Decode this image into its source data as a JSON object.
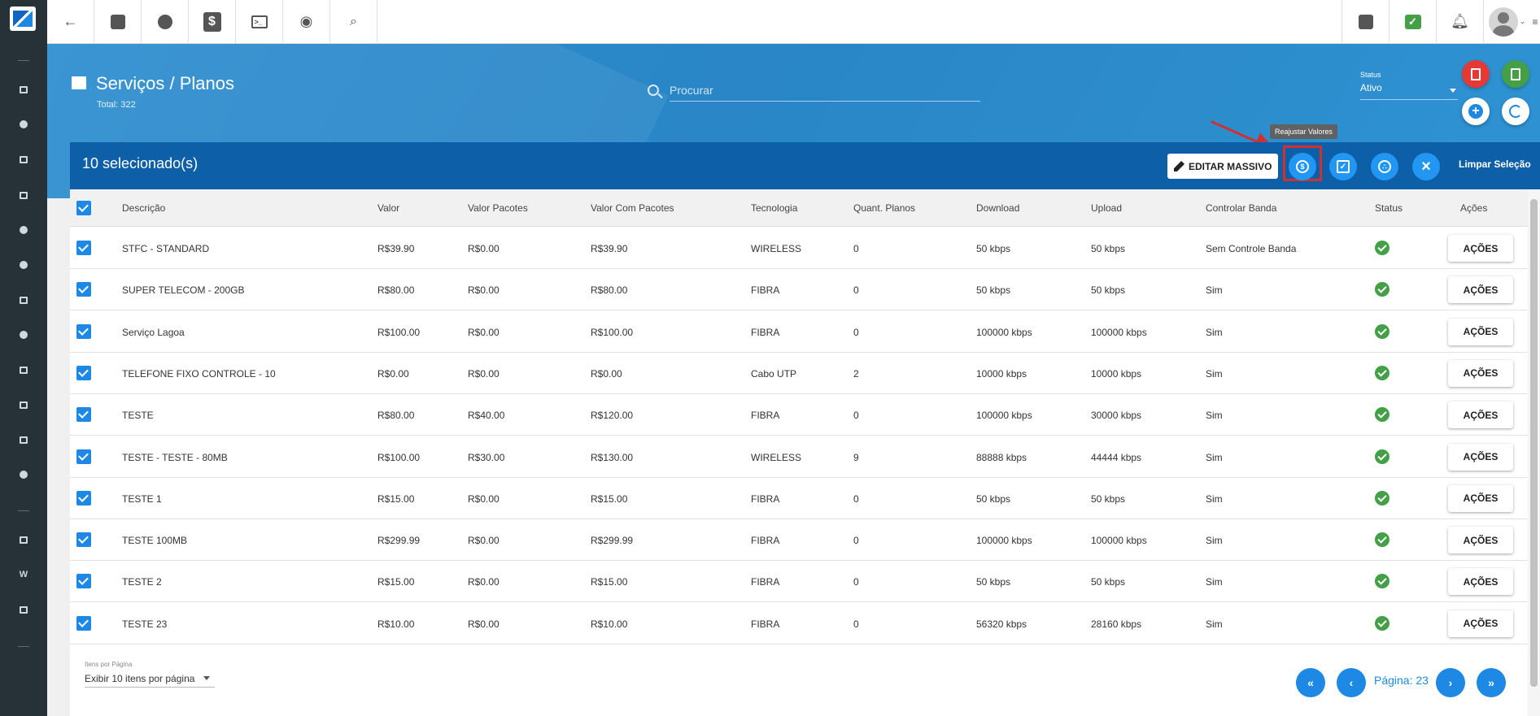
{
  "header": {
    "title": "Serviços / Planos",
    "total": "Total: 322",
    "search_placeholder": "Procurar",
    "status_label": "Status",
    "status_value": "Ativo"
  },
  "selection": {
    "count_label": "10 selecionado(s)",
    "edit_massivo_label": "EDITAR MASSIVO",
    "tooltip": "Reajustar Valores",
    "clear_label": "Limpar Seleção"
  },
  "table": {
    "columns": [
      "Descrição",
      "Valor",
      "Valor Pacotes",
      "Valor Com Pacotes",
      "Tecnologia",
      "Quant. Planos",
      "Download",
      "Upload",
      "Controlar Banda",
      "Status",
      "Ações"
    ],
    "action_label": "AÇÕES",
    "rows": [
      {
        "descricao": "STFC - STANDARD",
        "valor": "R$39.90",
        "valor_pacotes": "R$0.00",
        "valor_com_pacotes": "R$39.90",
        "tecnologia": "WIRELESS",
        "quant_planos": "0",
        "download": "50 kbps",
        "upload": "50 kbps",
        "controlar_banda": "Sem Controle Banda"
      },
      {
        "descricao": "SUPER TELECOM - 200GB",
        "valor": "R$80.00",
        "valor_pacotes": "R$0.00",
        "valor_com_pacotes": "R$80.00",
        "tecnologia": "FIBRA",
        "quant_planos": "0",
        "download": "50 kbps",
        "upload": "50 kbps",
        "controlar_banda": "Sim"
      },
      {
        "descricao": "Serviço Lagoa",
        "valor": "R$100.00",
        "valor_pacotes": "R$0.00",
        "valor_com_pacotes": "R$100.00",
        "tecnologia": "FIBRA",
        "quant_planos": "0",
        "download": "100000 kbps",
        "upload": "100000 kbps",
        "controlar_banda": "Sim"
      },
      {
        "descricao": "TELEFONE FIXO CONTROLE - 10",
        "valor": "R$0.00",
        "valor_pacotes": "R$0.00",
        "valor_com_pacotes": "R$0.00",
        "tecnologia": "Cabo UTP",
        "quant_planos": "2",
        "download": "10000 kbps",
        "upload": "10000 kbps",
        "controlar_banda": "Sim"
      },
      {
        "descricao": "TESTE",
        "valor": "R$80.00",
        "valor_pacotes": "R$40.00",
        "valor_com_pacotes": "R$120.00",
        "tecnologia": "FIBRA",
        "quant_planos": "0",
        "download": "100000 kbps",
        "upload": "30000 kbps",
        "controlar_banda": "Sim"
      },
      {
        "descricao": "TESTE - TESTE - 80MB",
        "valor": "R$100.00",
        "valor_pacotes": "R$30.00",
        "valor_com_pacotes": "R$130.00",
        "tecnologia": "WIRELESS",
        "quant_planos": "9",
        "download": "88888 kbps",
        "upload": "44444 kbps",
        "controlar_banda": "Sim"
      },
      {
        "descricao": "TESTE 1",
        "valor": "R$15.00",
        "valor_pacotes": "R$0.00",
        "valor_com_pacotes": "R$15.00",
        "tecnologia": "FIBRA",
        "quant_planos": "0",
        "download": "50 kbps",
        "upload": "50 kbps",
        "controlar_banda": "Sim"
      },
      {
        "descricao": "TESTE 100MB",
        "valor": "R$299.99",
        "valor_pacotes": "R$0.00",
        "valor_com_pacotes": "R$299.99",
        "tecnologia": "FIBRA",
        "quant_planos": "0",
        "download": "100000 kbps",
        "upload": "100000 kbps",
        "controlar_banda": "Sim"
      },
      {
        "descricao": "TESTE 2",
        "valor": "R$15.00",
        "valor_pacotes": "R$0.00",
        "valor_com_pacotes": "R$15.00",
        "tecnologia": "FIBRA",
        "quant_planos": "0",
        "download": "50 kbps",
        "upload": "50 kbps",
        "controlar_banda": "Sim"
      },
      {
        "descricao": "TESTE 23",
        "valor": "R$10.00",
        "valor_pacotes": "R$0.00",
        "valor_com_pacotes": "R$10.00",
        "tecnologia": "FIBRA",
        "quant_planos": "0",
        "download": "56320 kbps",
        "upload": "28160 kbps",
        "controlar_banda": "Sim"
      }
    ]
  },
  "footer": {
    "per_page_label": "Itens por Página",
    "per_page_value": "Exibir 10 itens por página",
    "page_label": "Página: 23"
  },
  "colors": {
    "accent": "#1e88e5",
    "selection_bar": "#0d5fa8",
    "sidebar": "#263238",
    "status_ok": "#43a047",
    "highlight": "#d32f2f"
  }
}
